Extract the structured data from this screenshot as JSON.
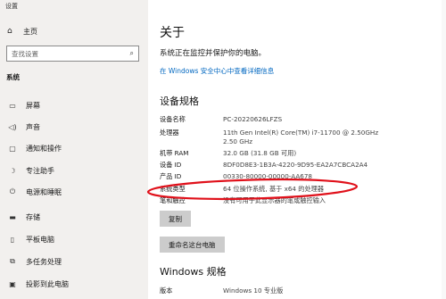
{
  "window": {
    "title": "设置"
  },
  "sidebar": {
    "home": "主页",
    "search_placeholder": "查找设置",
    "section": "系统",
    "items": [
      {
        "label": "屏幕",
        "icon": "monitor-icon"
      },
      {
        "label": "声音",
        "icon": "speaker-icon"
      },
      {
        "label": "通知和操作",
        "icon": "notification-icon"
      },
      {
        "label": "专注助手",
        "icon": "moon-icon"
      },
      {
        "label": "电源和睡眠",
        "icon": "power-icon"
      },
      {
        "label": "存储",
        "icon": "storage-icon"
      },
      {
        "label": "平板电脑",
        "icon": "tablet-icon"
      },
      {
        "label": "多任务处理",
        "icon": "multitask-icon"
      },
      {
        "label": "投影到此电脑",
        "icon": "project-icon"
      }
    ]
  },
  "main": {
    "title": "关于",
    "protect_text": "系统正在监控并保护你的电脑。",
    "details_link": "在 Windows 安全中心中查看详细信息",
    "spec_heading": "设备规格",
    "specs": [
      {
        "key": "设备名称",
        "value": "PC-20220626LFZS"
      },
      {
        "key": "处理器",
        "value": "11th Gen Intel(R) Core(TM) i7-11700 @ 2.50GHz",
        "value2": "2.50 GHz"
      },
      {
        "key": "机带 RAM",
        "value": "32.0 GB (31.8 GB 可用)"
      },
      {
        "key": "设备 ID",
        "value": "8DF0D8E3-1B3A-4220-9D95-EA2A7CBCA2A4"
      },
      {
        "key": "产品 ID",
        "value": "00330-80000-00000-AA678"
      },
      {
        "key": "系统类型",
        "value": "64 位操作系统, 基于 x64 的处理器"
      },
      {
        "key": "笔和触控",
        "value": "没有可用于此显示器的笔或触控输入"
      }
    ],
    "copy_button": "复制",
    "rename_button": "重命名这台电脑",
    "win_heading": "Windows 规格",
    "edition_key": "版本",
    "edition_value": "Windows 10 专业版"
  },
  "colors": {
    "sidebar_bg": "#f2f0ee",
    "link": "#0067c0",
    "annotation": "#e0101a"
  }
}
